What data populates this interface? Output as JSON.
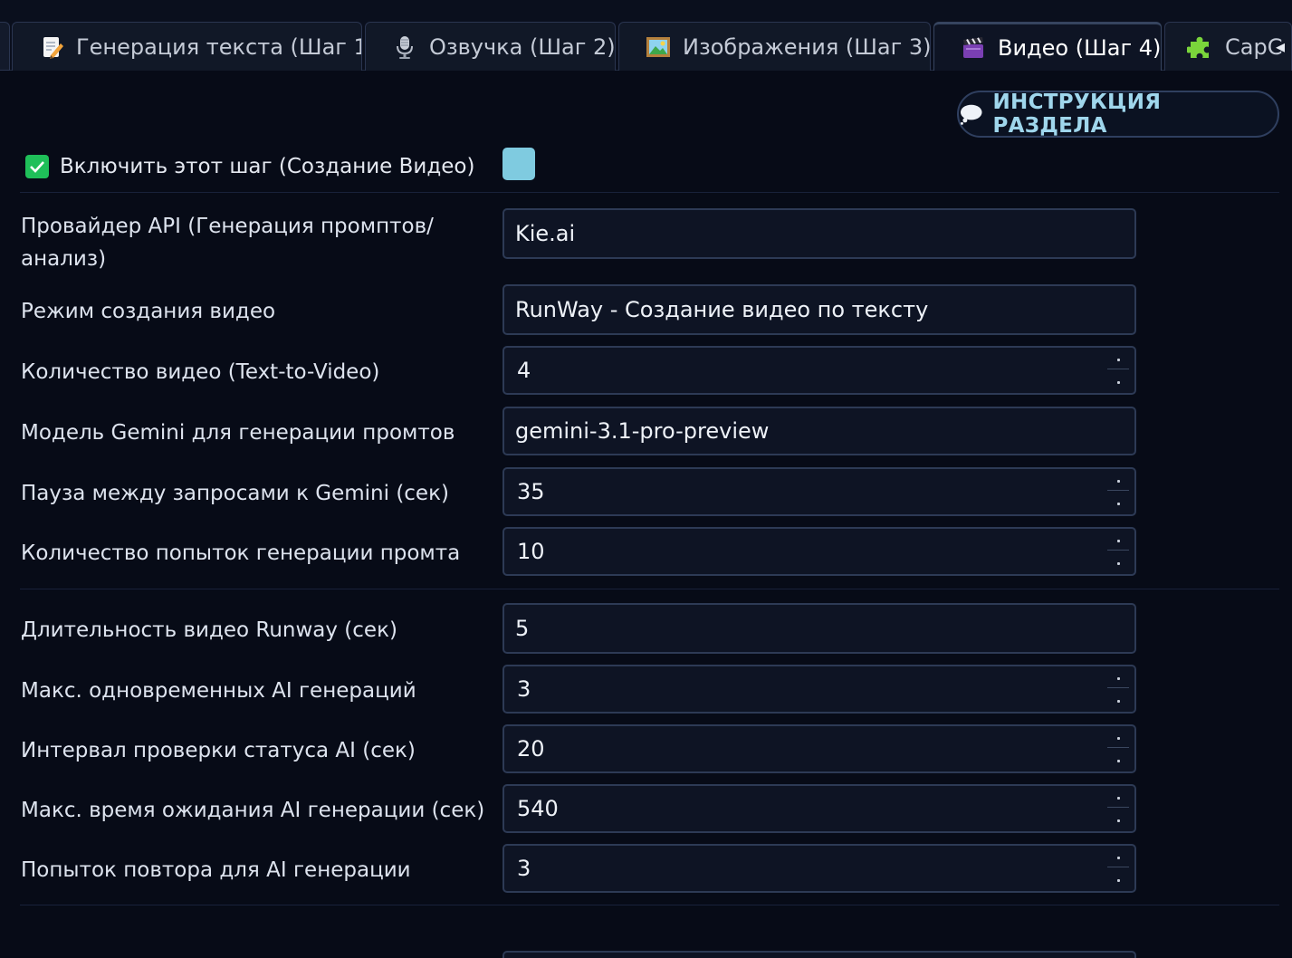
{
  "tabs": [
    {
      "label": "Генерация текста (Шаг 1)",
      "icon": "memo-icon"
    },
    {
      "label": "Озвучка (Шаг 2)",
      "icon": "microphone-icon"
    },
    {
      "label": "Изображения (Шаг 3)",
      "icon": "framed-picture-icon"
    },
    {
      "label": "Видео (Шаг 4)",
      "icon": "clapper-board-icon",
      "active": true
    },
    {
      "label": "CapC",
      "icon": "puzzle-piece-icon"
    }
  ],
  "instruction_button": {
    "label": "ИНСТРУКЦИЯ РАЗДЕЛА",
    "icon": "speech-bubble-icon"
  },
  "enable_step": {
    "label": "Включить этот шаг (Создание Видео)",
    "checked": true,
    "swatch_color": "#7fcbe0"
  },
  "fields": [
    {
      "label": "Провайдер API (Генерация промптов/ анализ)",
      "value": "Kie.ai",
      "type": "text"
    },
    {
      "label": "Режим создания видео",
      "value": "RunWay - Создание видео по тексту",
      "type": "text"
    },
    {
      "label": "Количество видео (Text-to-Video)",
      "value": "4",
      "type": "spin"
    },
    {
      "label": "Модель Gemini для генерации промтов",
      "value": "gemini-3.1-pro-preview",
      "type": "text"
    },
    {
      "label": "Пауза между запросами к Gemini (сек)",
      "value": "35",
      "type": "spin"
    },
    {
      "label": "Количество попыток генерации промта",
      "value": "10",
      "type": "spin"
    },
    {
      "label": "Длительность видео Runway (сек)",
      "value": "5",
      "type": "text"
    },
    {
      "label": "Макс. одновременных AI генераций",
      "value": "3",
      "type": "spin"
    },
    {
      "label": "Интервал проверки статуса AI (сек)",
      "value": "20",
      "type": "spin"
    },
    {
      "label": "Макс. время ожидания AI генерации (сек)",
      "value": "540",
      "type": "spin"
    },
    {
      "label": "Попыток повтора для AI генерации",
      "value": "3",
      "type": "spin"
    }
  ],
  "colors": {
    "accent": "#7fd0ea",
    "checkbox": "#1fbf59",
    "background": "#070b17"
  }
}
